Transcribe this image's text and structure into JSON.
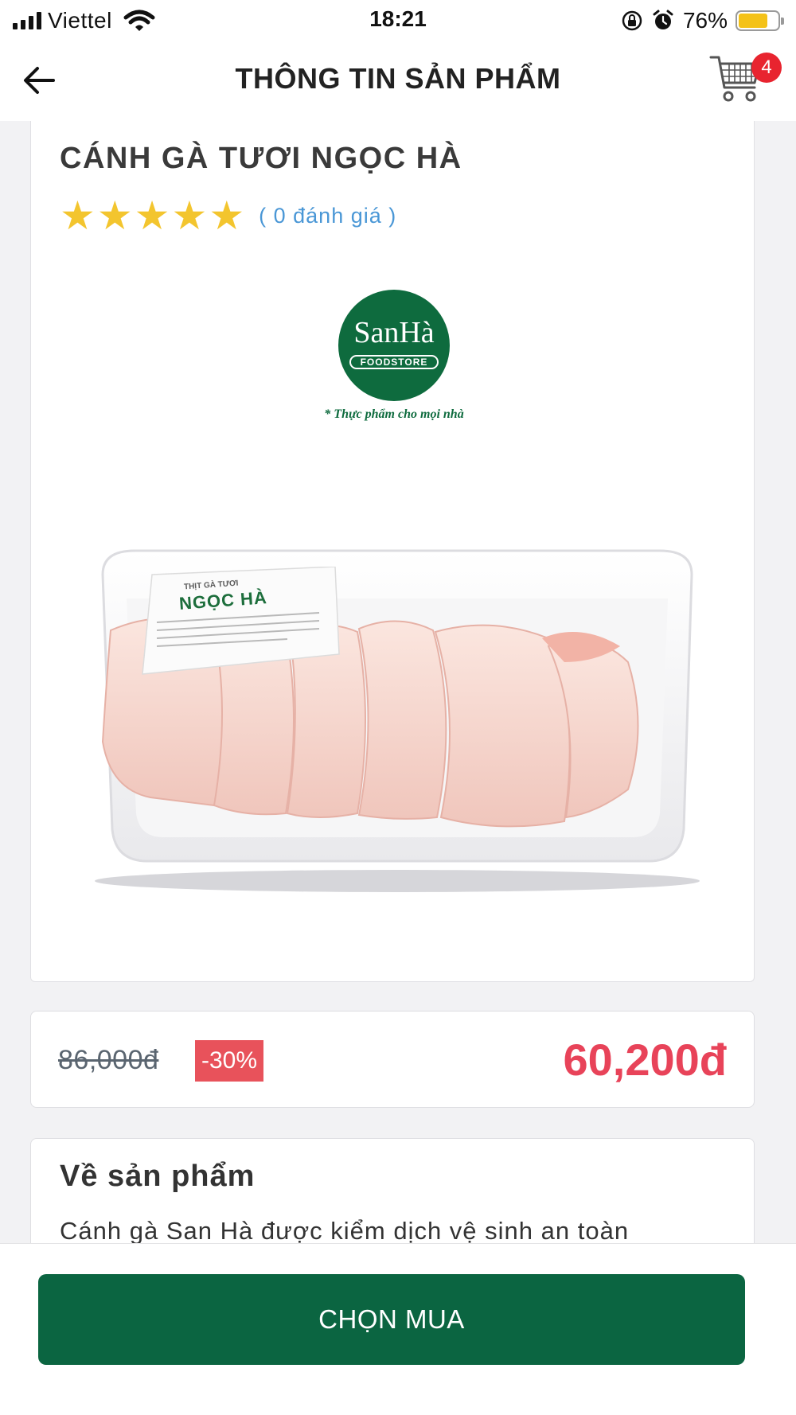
{
  "status_bar": {
    "carrier": "Viettel",
    "time": "18:21",
    "battery_percent": "76%",
    "battery_level": 0.76,
    "icons": [
      "signal-icon",
      "wifi-icon",
      "rotation-lock-icon",
      "alarm-icon",
      "battery-icon"
    ]
  },
  "header": {
    "title": "THÔNG TIN SẢN PHẨM",
    "back_icon": "arrow-left-icon",
    "cart_icon": "shopping-cart-icon",
    "cart_count": "4"
  },
  "product": {
    "title": "CÁNH GÀ TƯƠI NGỌC HÀ",
    "rating_stars": 5,
    "review_count": "( 0 đánh giá )",
    "image": {
      "brand_name": "SanHà",
      "brand_sub": "FOODSTORE",
      "brand_tagline": "* Thực phẩm cho mọi nhà",
      "pack_label_top": "THỊT GÀ TƯƠI",
      "pack_label_brand": "NGỌC HÀ"
    }
  },
  "pricing": {
    "old_price": "86,000đ",
    "discount": "-30%",
    "new_price": "60,200đ"
  },
  "about": {
    "title": "Về sản phẩm",
    "text": "Cánh gà San Hà được kiểm dịch vệ sinh an toàn"
  },
  "actions": {
    "buy_label": "CHỌN MUA"
  },
  "colors": {
    "brand_green": "#0b6541",
    "price_red": "#e84359",
    "discount_red": "#e8525b",
    "star_yellow": "#f3c52e",
    "link_blue": "#4a97d6",
    "badge_red": "#e8242f"
  }
}
